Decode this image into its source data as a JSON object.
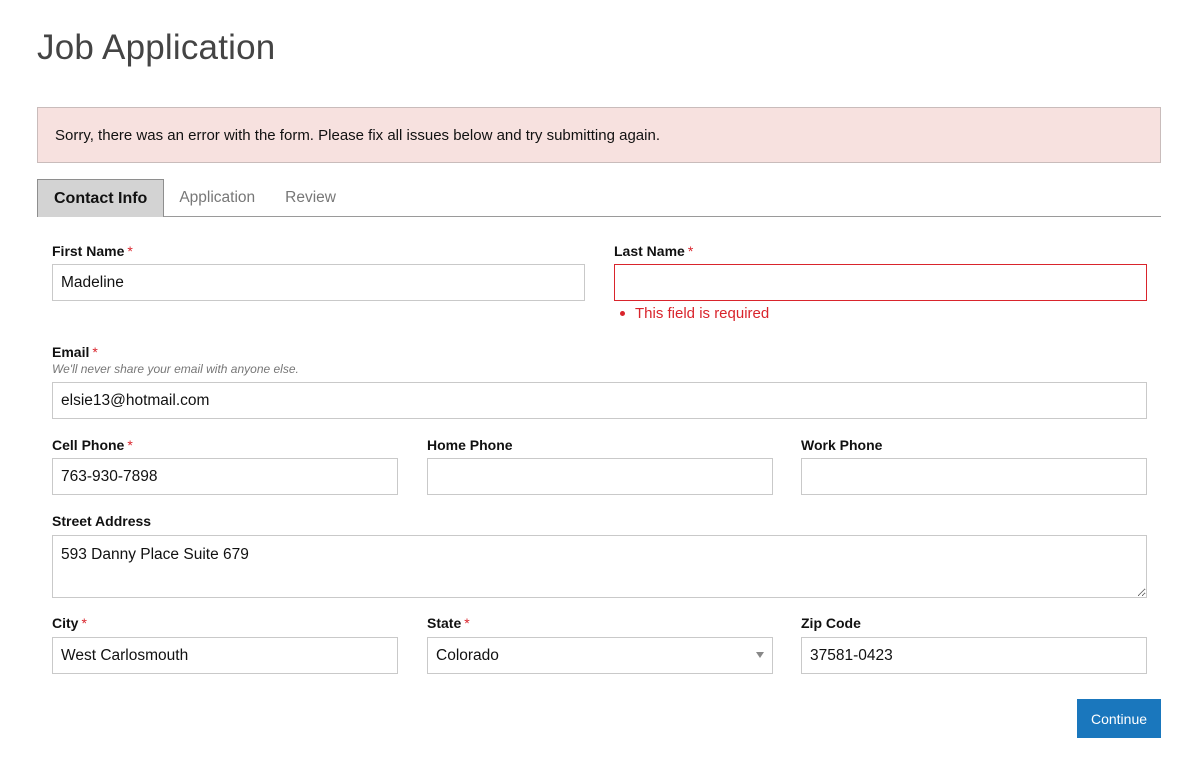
{
  "page": {
    "title": "Job Application"
  },
  "error_banner": {
    "message": "Sorry, there was an error with the form. Please fix all issues below and try submitting again."
  },
  "tabs": [
    {
      "label": "Contact Info",
      "active": true
    },
    {
      "label": "Application",
      "active": false
    },
    {
      "label": "Review",
      "active": false
    }
  ],
  "form": {
    "required_marker": "*",
    "first_name": {
      "label": "First Name",
      "required": true,
      "value": "Madeline"
    },
    "last_name": {
      "label": "Last Name",
      "required": true,
      "value": "",
      "error": "This field is required"
    },
    "email": {
      "label": "Email",
      "required": true,
      "help": "We'll never share your email with anyone else.",
      "value": "elsie13@hotmail.com"
    },
    "cell_phone": {
      "label": "Cell Phone",
      "required": true,
      "value": "763-930-7898"
    },
    "home_phone": {
      "label": "Home Phone",
      "required": false,
      "value": ""
    },
    "work_phone": {
      "label": "Work Phone",
      "required": false,
      "value": ""
    },
    "street_address": {
      "label": "Street Address",
      "required": false,
      "value": "593 Danny Place Suite 679"
    },
    "city": {
      "label": "City",
      "required": true,
      "value": "West Carlosmouth"
    },
    "state": {
      "label": "State",
      "required": true,
      "value": "Colorado"
    },
    "zip_code": {
      "label": "Zip Code",
      "required": false,
      "value": "37581-0423"
    }
  },
  "actions": {
    "continue_label": "Continue"
  },
  "colors": {
    "error": "#d9242c",
    "primary_button": "#1a77bd",
    "error_banner_bg": "#f7e1df"
  }
}
